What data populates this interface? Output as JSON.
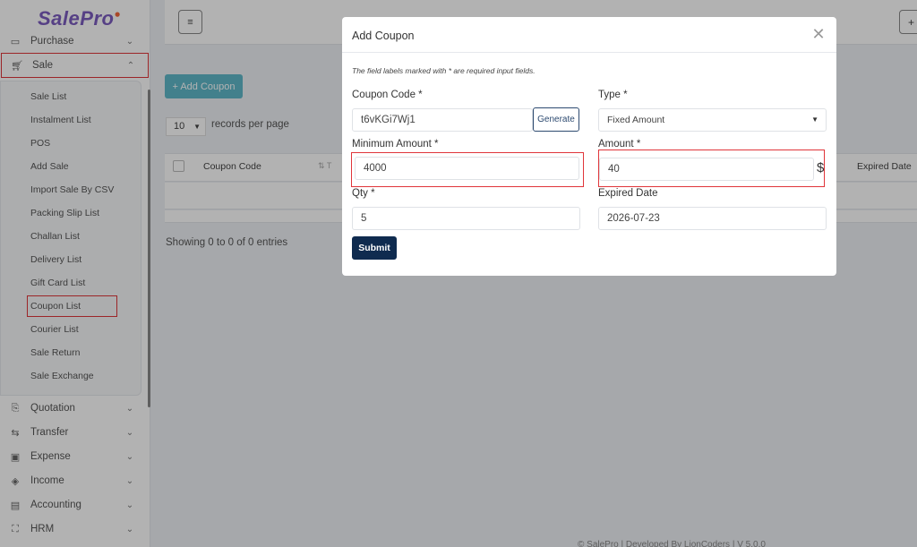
{
  "brand": {
    "name_part1": "Sale",
    "name_part2": "Pro"
  },
  "sidebar": {
    "items_top": [
      {
        "label": "Purchase",
        "icon": "truck-icon"
      },
      {
        "label": "Sale",
        "icon": "cart-icon"
      }
    ],
    "sale_submenu": [
      "Sale List",
      "Instalment List",
      "POS",
      "Add Sale",
      "Import Sale By CSV",
      "Packing Slip List",
      "Challan List",
      "Delivery List",
      "Gift Card List",
      "Coupon List",
      "Courier List",
      "Sale Return",
      "Sale Exchange"
    ],
    "items_bottom": [
      {
        "label": "Quotation",
        "icon": "quotation-icon"
      },
      {
        "label": "Transfer",
        "icon": "transfer-icon"
      },
      {
        "label": "Expense",
        "icon": "wallet-icon"
      },
      {
        "label": "Income",
        "icon": "income-icon"
      },
      {
        "label": "Accounting",
        "icon": "briefcase-icon"
      },
      {
        "label": "HRM",
        "icon": "users-icon"
      }
    ]
  },
  "main": {
    "add_coupon_label": "+ Add Coupon",
    "records_value": "10",
    "records_label": "records per page",
    "table": {
      "col_coupon_code": "Coupon Code",
      "col_expired_date": "Expired Date",
      "col_type_initial": "T"
    },
    "showing": "Showing 0 to 0 of 0 entries",
    "footer": "© SalePro | Developed By LionCoders | V 5.0.0"
  },
  "modal": {
    "title": "Add Coupon",
    "required_note": "The field labels marked with * are required input fields.",
    "coupon_code": {
      "label": "Coupon Code *",
      "value": "t6vKGi7Wj1",
      "generate_label": "Generate"
    },
    "type": {
      "label": "Type *",
      "value": "Fixed Amount"
    },
    "minimum_amount": {
      "label": "Minimum Amount *",
      "value": "4000"
    },
    "amount": {
      "label": "Amount *",
      "value": "40",
      "currency": "$"
    },
    "qty": {
      "label": "Qty *",
      "value": "5"
    },
    "expired_date": {
      "label": "Expired Date",
      "value": "2026-07-23"
    },
    "submit_label": "Submit"
  },
  "colors": {
    "accent": "#0f2b4f",
    "highlight": "#e0353a",
    "add_button": "#5fb8c9",
    "brand": "#7c5cbf"
  }
}
